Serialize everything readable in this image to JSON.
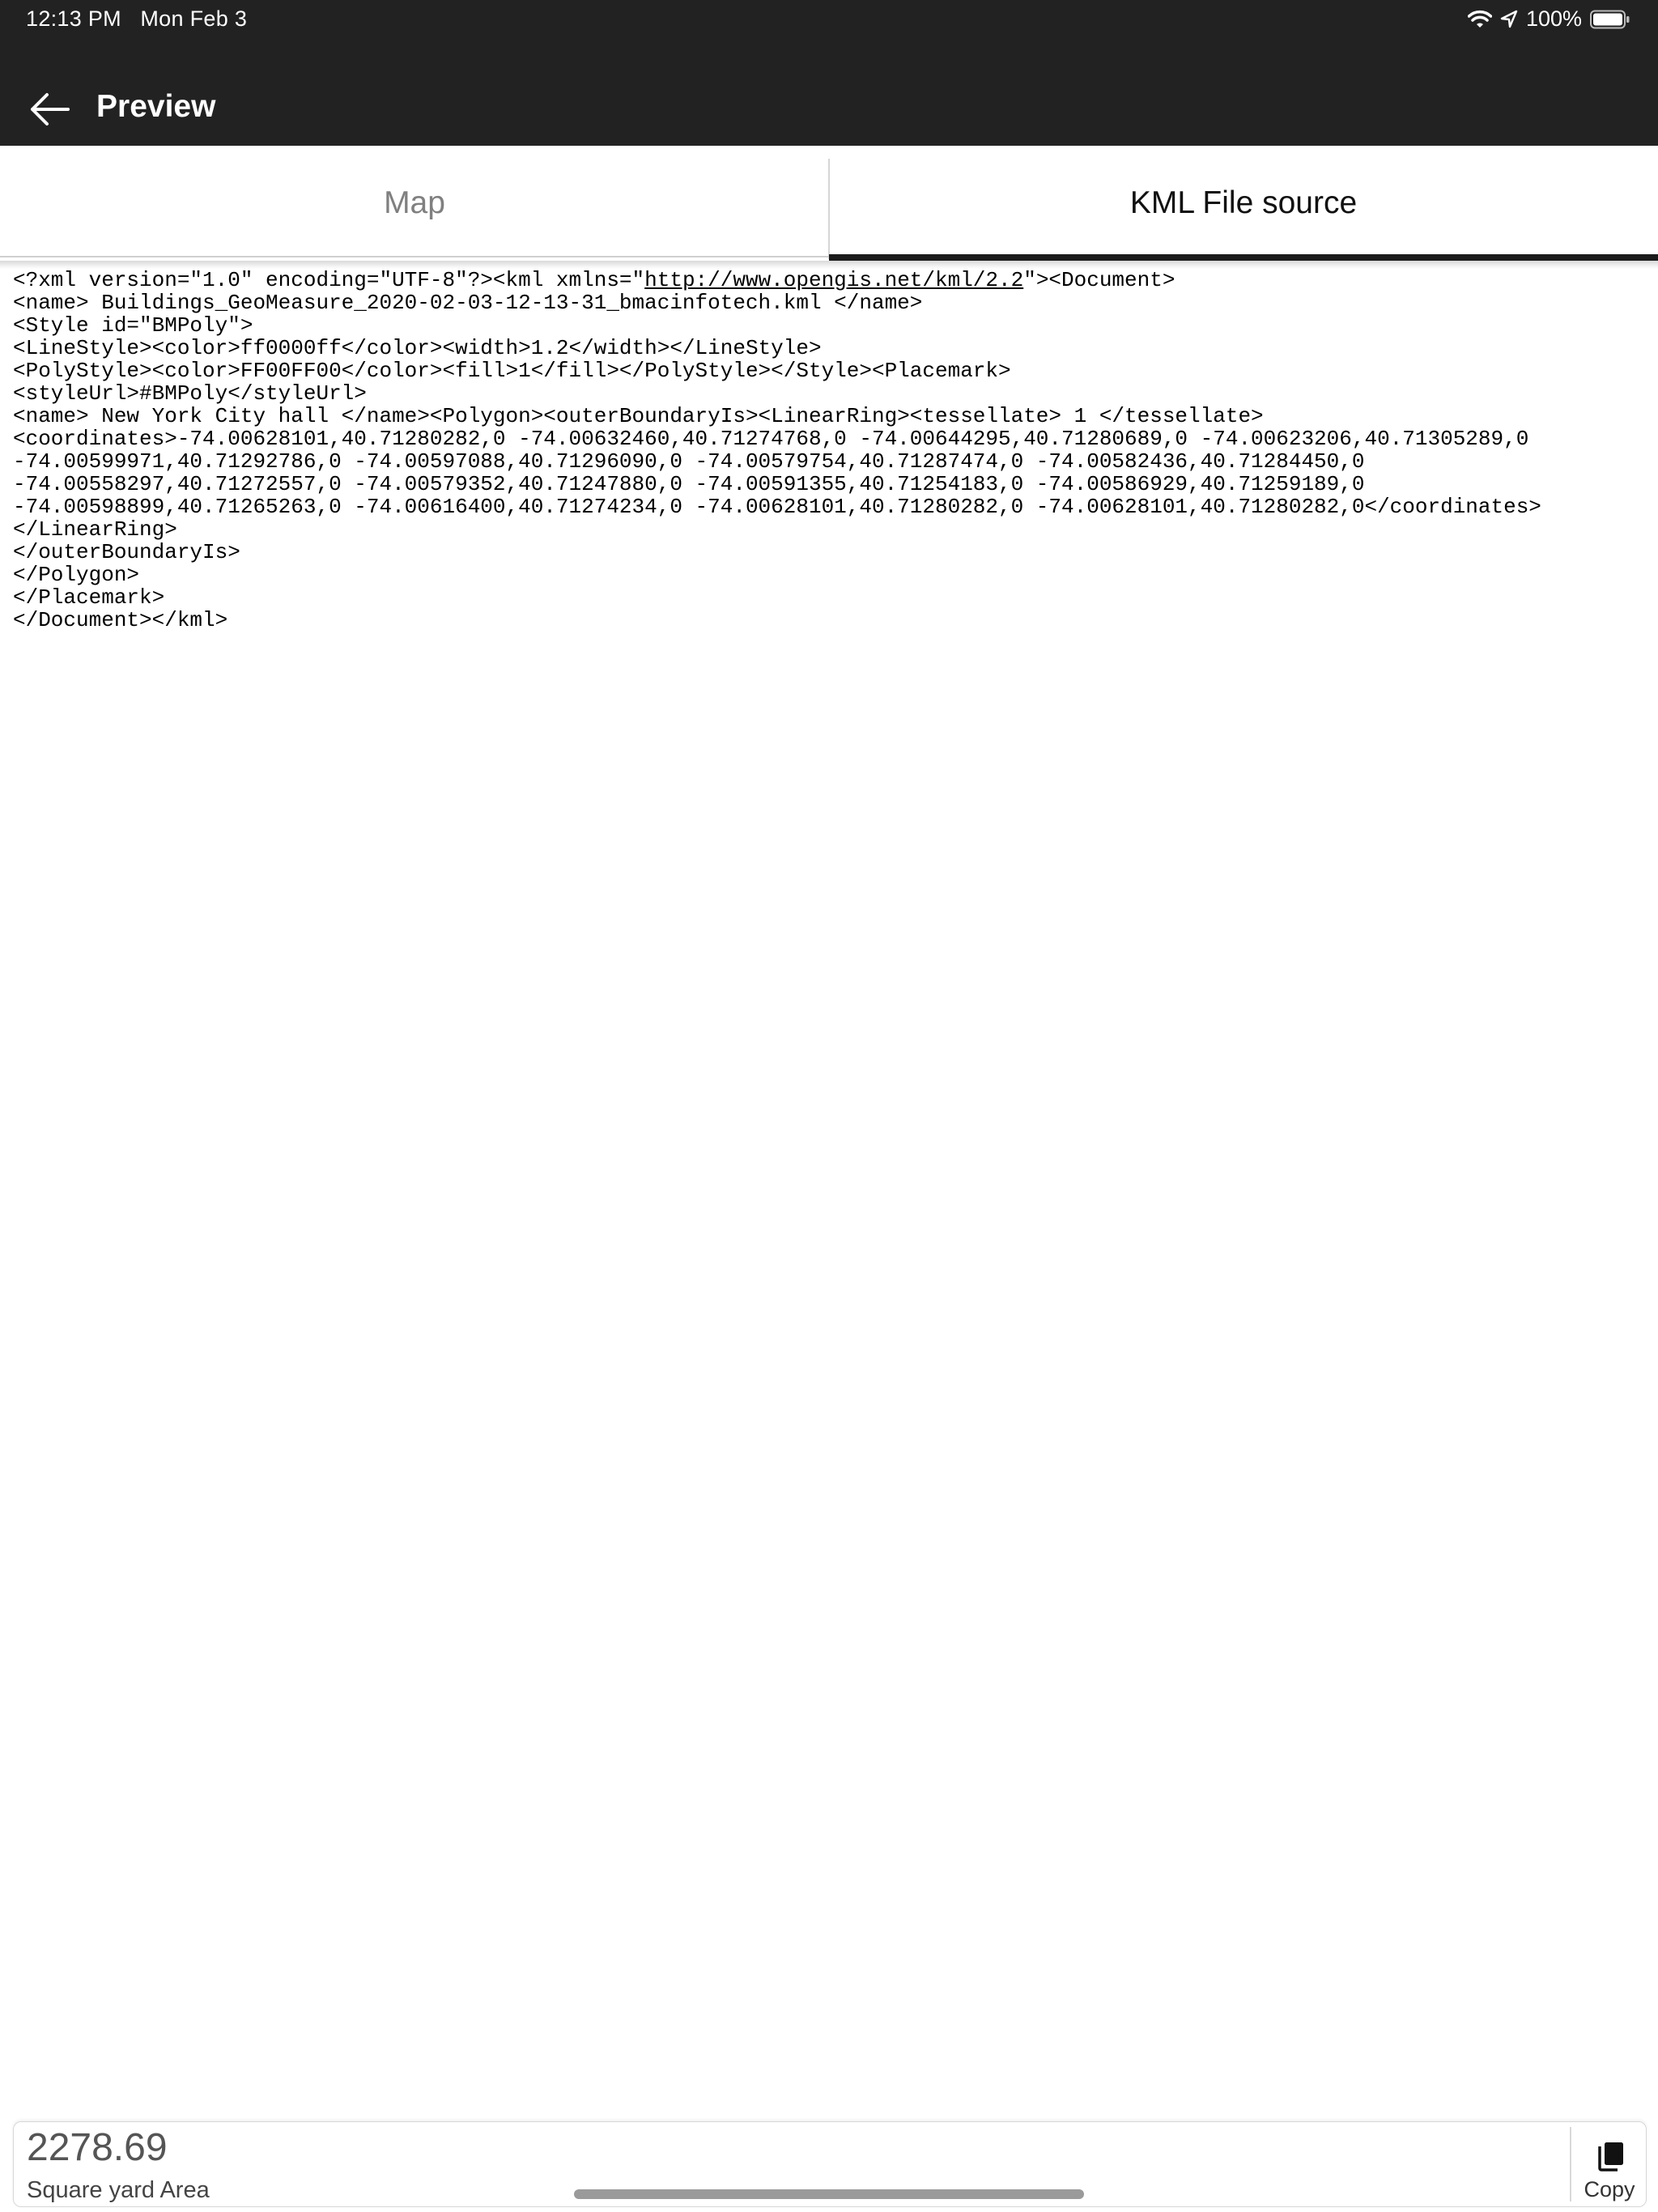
{
  "status_bar": {
    "time": "12:13 PM",
    "date": "Mon Feb 3",
    "battery": "100%"
  },
  "nav": {
    "title": "Preview"
  },
  "tabs": [
    {
      "label": "Map",
      "active": false
    },
    {
      "label": "KML File source",
      "active": true
    }
  ],
  "kml": {
    "line1_before_link": "<?xml version=\"1.0\" encoding=\"UTF-8\"?><kml xmlns=\"",
    "line1_link": "http://www.opengis.net/kml/2.2",
    "line1_after_link": "\"><Document>",
    "rest": "<name> Buildings_GeoMeasure_2020-02-03-12-13-31_bmacinfotech.kml </name>\n<Style id=\"BMPoly\">\n<LineStyle><color>ff0000ff</color><width>1.2</width></LineStyle>\n<PolyStyle><color>FF00FF00</color><fill>1</fill></PolyStyle></Style><Placemark>\n<styleUrl>#BMPoly</styleUrl>\n<name> New York City hall </name><Polygon><outerBoundaryIs><LinearRing><tessellate> 1 </tessellate>\n<coordinates>-74.00628101,40.71280282,0 -74.00632460,40.71274768,0 -74.00644295,40.71280689,0 -74.00623206,40.71305289,0\n-74.00599971,40.71292786,0 -74.00597088,40.71296090,0 -74.00579754,40.71287474,0 -74.00582436,40.71284450,0\n-74.00558297,40.71272557,0 -74.00579352,40.71247880,0 -74.00591355,40.71254183,0 -74.00586929,40.71259189,0\n-74.00598899,40.71265263,0 -74.00616400,40.71274234,0 -74.00628101,40.71280282,0 -74.00628101,40.71280282,0</coordinates>\n</LinearRing>\n</outerBoundaryIs>\n</Polygon>\n</Placemark>\n</Document></kml>"
  },
  "area": {
    "value": "2278.69",
    "label": "Square yard Area",
    "copy_label": "Copy"
  },
  "icons": {
    "back": "arrow-left-icon",
    "wifi": "wifi-icon",
    "location": "location-arrow-icon",
    "battery": "battery-icon",
    "copy": "copy-icon"
  }
}
